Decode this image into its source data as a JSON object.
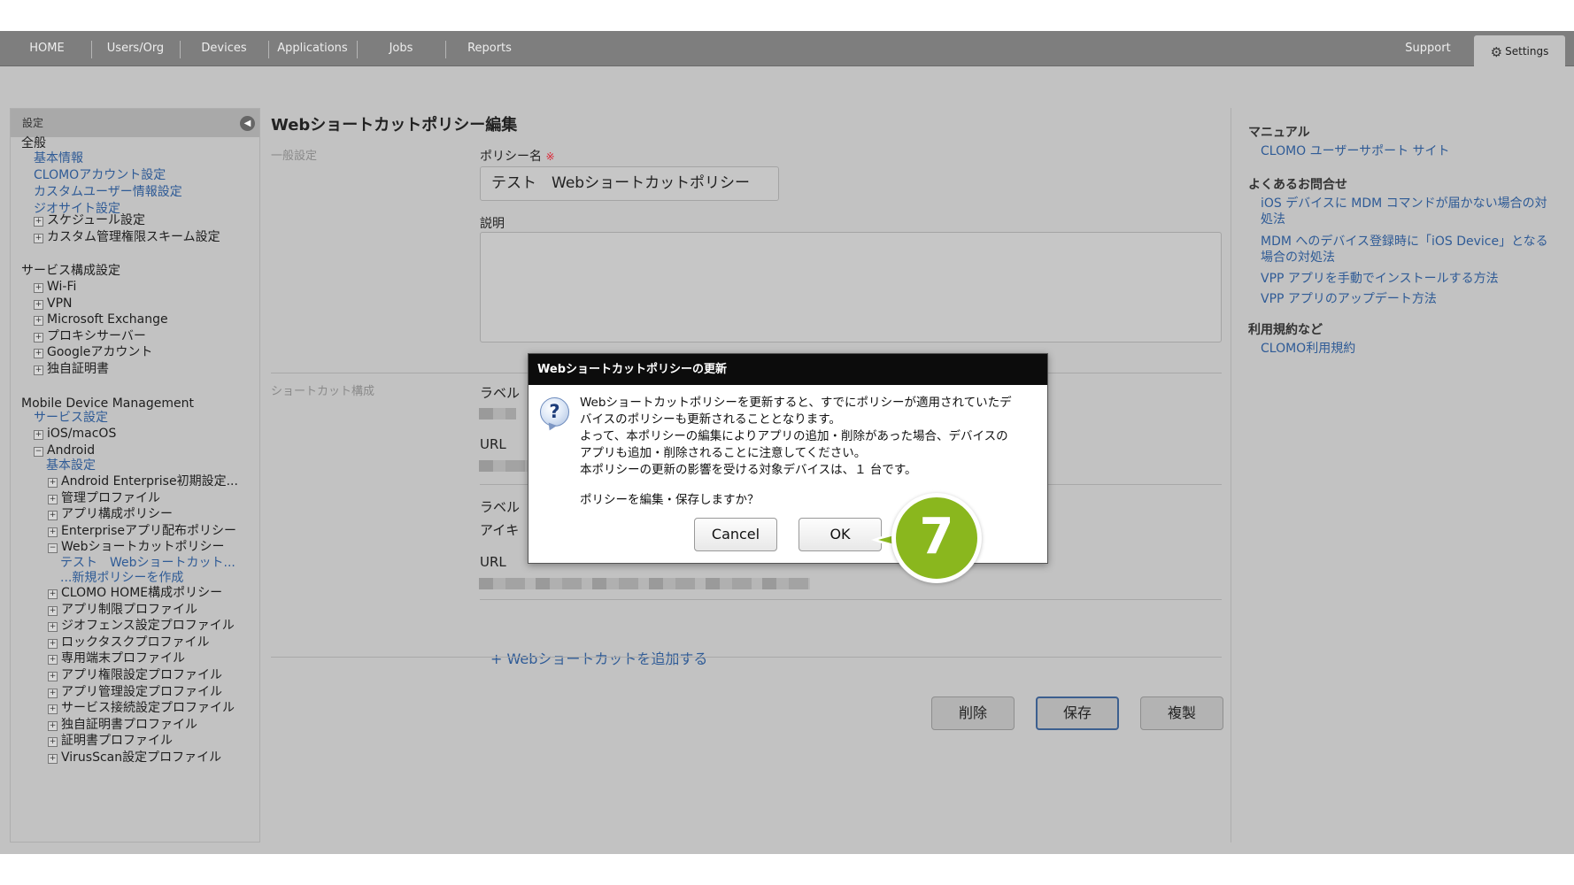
{
  "nav": {
    "items": [
      "HOME",
      "Users/Org",
      "Devices",
      "Applications",
      "Jobs",
      "Reports"
    ],
    "support": "Support",
    "settings": "Settings"
  },
  "sidebar": {
    "header": "設定",
    "all": "全般",
    "general_links": [
      "基本情報",
      "CLOMOアカウント設定",
      "カスタムユーザー情報設定",
      "ジオサイト設定"
    ],
    "general_expand": [
      "スケジュール設定",
      "カスタム管理権限スキーム設定"
    ],
    "service_title": "サービス構成設定",
    "service_items": [
      "Wi-Fi",
      "VPN",
      "Microsoft Exchange",
      "プロキシサーバー",
      "Googleアカウント",
      "独自証明書"
    ],
    "mdm_title": "Mobile Device Management",
    "mdm_service": "サービス設定",
    "ios": "iOS/macOS",
    "android": "Android",
    "android_basic": "基本設定",
    "android_items_before": [
      "Android Enterprise初期設定...",
      "管理プロファイル",
      "アプリ構成ポリシー",
      "Enterpriseアプリ配布ポリシー",
      "Webショートカットポリシー"
    ],
    "web_sub_links": [
      "テスト　Webショートカット...",
      "...新規ポリシーを作成"
    ],
    "android_items_after": [
      "CLOMO HOME構成ポリシー",
      "アプリ制限プロファイル",
      "ジオフェンス設定プロファイル",
      "ロックタスクプロファイル",
      "専用端末プロファイル",
      "アプリ権限設定プロファイル",
      "アプリ管理設定プロファイル",
      "サービス接続設定プロファイル",
      "独自証明書プロファイル",
      "証明書プロファイル",
      "VirusScan設定プロファイル"
    ]
  },
  "main": {
    "title": "Webショートカットポリシー編集",
    "general_section": "一般設定",
    "policy_name_label": "ポリシー名",
    "required_mark": "※",
    "policy_name_value": "テスト　Webショートカットポリシー",
    "description_label": "説明",
    "shortcut_section": "ショートカット構成",
    "label_label": "ラベル",
    "url_label": "URL",
    "icon_label": "アイキ",
    "add_shortcut": "+ Webショートカットを追加する",
    "buttons": {
      "delete": "削除",
      "save": "保存",
      "copy": "複製"
    }
  },
  "right": {
    "manual_title": "マニュアル",
    "manual_link": "CLOMO ユーザーサポート サイト",
    "faq_title": "よくあるお問合せ",
    "faq_links": [
      [
        "iOS デバイスに MDM コマンドが届かない場合の対",
        "処法"
      ],
      [
        "MDM へのデバイス登録時に「iOS Device」となる",
        "場合の対処法"
      ],
      [
        "VPP アプリを手動でインストールする方法"
      ],
      [
        "VPP アプリのアップデート方法"
      ]
    ],
    "terms_title": "利用規約など",
    "terms_link": "CLOMO利用規約"
  },
  "modal": {
    "title": "Webショートカットポリシーの更新",
    "message_lines": [
      "Webショートカットポリシーを更新すると、すでにポリシーが適用されていたデ",
      "バイスのポリシーも更新されることとなります。",
      "よって、本ポリシーの編集によりアプリの追加・削除があった場合、デバイスの",
      "アプリも追加・削除されることに注意してください。",
      "本ポリシーの更新の影響を受ける対象デバイスは、１ 台です。"
    ],
    "question": "ポリシーを編集・保存しますか？",
    "cancel": "Cancel",
    "ok": "OK"
  },
  "step_number": "7",
  "colors": {
    "accent_green": "#8ab71e",
    "link_blue": "#2f5b96",
    "nav_gray": "#7e7e7e"
  }
}
